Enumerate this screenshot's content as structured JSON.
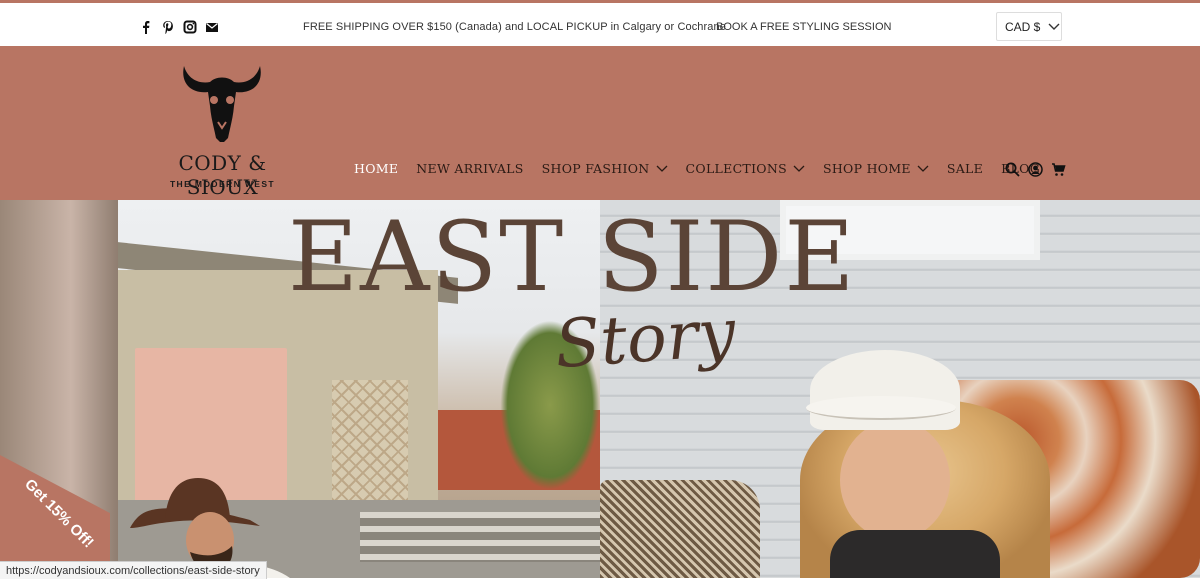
{
  "announcement": {
    "shipping": "FREE SHIPPING OVER $150 (Canada) and LOCAL PICKUP in Calgary or Cochrane",
    "book": "BOOK A FREE STYLING SESSION",
    "currency": "CAD $",
    "social_icons": [
      "facebook-icon",
      "pinterest-icon",
      "instagram-icon",
      "email-icon"
    ]
  },
  "brand": {
    "name": "CODY & SIOUX",
    "tagline": "THE MODERN WEST"
  },
  "nav": {
    "items": [
      {
        "label": "HOME",
        "active": true
      },
      {
        "label": "NEW ARRIVALS"
      },
      {
        "label": "SHOP FASHION",
        "dropdown": true
      },
      {
        "label": "COLLECTIONS",
        "dropdown": true
      },
      {
        "label": "SHOP HOME",
        "dropdown": true
      },
      {
        "label": "SALE"
      },
      {
        "label": "BLOG"
      }
    ],
    "icons": [
      "search-icon",
      "account-icon",
      "cart-icon"
    ]
  },
  "hero": {
    "heading": "EAST SIDE",
    "script": "Story"
  },
  "promo": {
    "label": "Get 15% Off!"
  },
  "status_bar": {
    "url": "https://codyandsioux.com/collections/east-side-story"
  },
  "colors": {
    "brand_terracotta": "#b87563",
    "heading_brown": "#5b4437"
  }
}
